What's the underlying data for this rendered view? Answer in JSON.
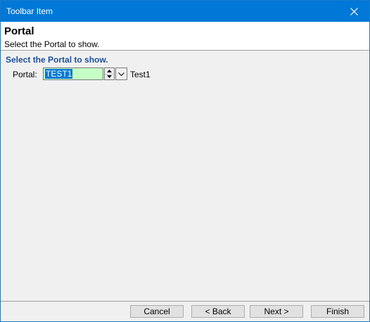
{
  "window": {
    "title": "Toolbar Item",
    "close_icon": "close-icon"
  },
  "header": {
    "heading": "Portal",
    "subheading": "Select the Portal to show."
  },
  "content": {
    "section_title": "Select the Portal to show.",
    "portal_label": "Portal:",
    "portal_value": "TEST1",
    "portal_name": "Test1",
    "input_bg_color": "#c6ffc6"
  },
  "buttons": {
    "cancel": "Cancel",
    "back": "< Back",
    "next": "Next >",
    "finish": "Finish"
  },
  "colors": {
    "titlebar": "#0078d7",
    "section_title": "#1c4e9a"
  }
}
